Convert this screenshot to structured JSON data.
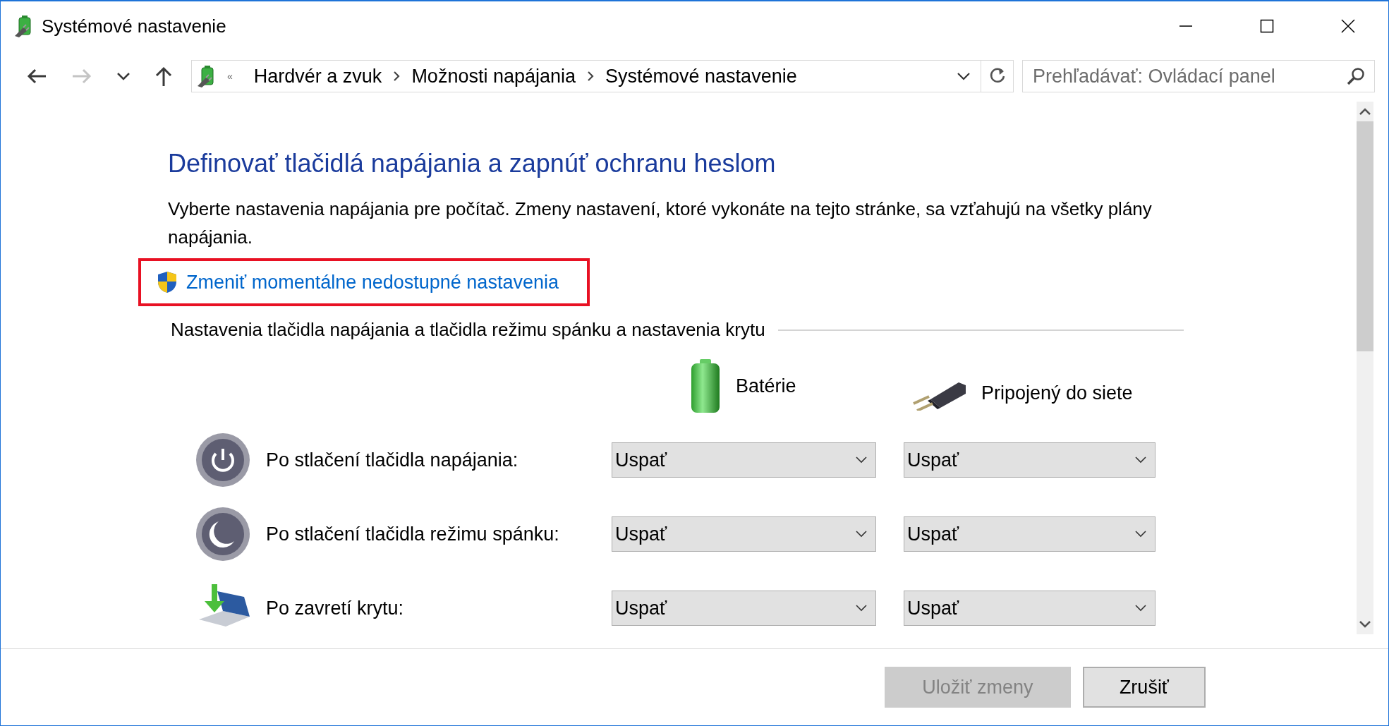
{
  "window": {
    "title": "Systémové nastavenie"
  },
  "navigation": [
    {
      "kind": "back",
      "disabled": false
    },
    {
      "kind": "forward",
      "disabled": true
    },
    {
      "kind": "recent",
      "disabled": false
    },
    {
      "kind": "up",
      "disabled": false
    }
  ],
  "address_bar": {
    "overflow": "«",
    "breadcrumbs": [
      "Hardvér a zvuk",
      "Možnosti napájania",
      "Systémové nastavenie"
    ]
  },
  "search": {
    "placeholder": "Prehľadávať: Ovládací panel"
  },
  "heading": "Definovať tlačidlá napájania a zapnúť ochranu heslom",
  "description": "Vyberte nastavenia napájania pre počítač. Zmeny nastavení, ktoré vykonáte na tejto stránke, sa vzťahujú na všetky plány napájania.",
  "admin_link": {
    "text": "Zmeniť momentálne nedostupné nastavenia",
    "highlighted": true
  },
  "section_title": "Nastavenia tlačidla napájania a tlačidla režimu spánku a nastavenia krytu",
  "columns": [
    {
      "kind": "battery",
      "label": "Batérie"
    },
    {
      "kind": "plugged",
      "label": "Pripojený do siete"
    }
  ],
  "rows": [
    {
      "kind": "power",
      "label": "Po stlačení tlačidla napájania:",
      "values": [
        "Uspať",
        "Uspať"
      ]
    },
    {
      "kind": "sleep",
      "label": "Po stlačení tlačidla režimu spánku:",
      "values": [
        "Uspať",
        "Uspať"
      ]
    },
    {
      "kind": "lid",
      "label": "Po zavretí krytu:",
      "values": [
        "Uspať",
        "Uspať"
      ]
    }
  ],
  "buttons": [
    {
      "label": "Uložiť zmeny",
      "disabled": true
    },
    {
      "label": "Zrušiť",
      "disabled": false
    }
  ]
}
